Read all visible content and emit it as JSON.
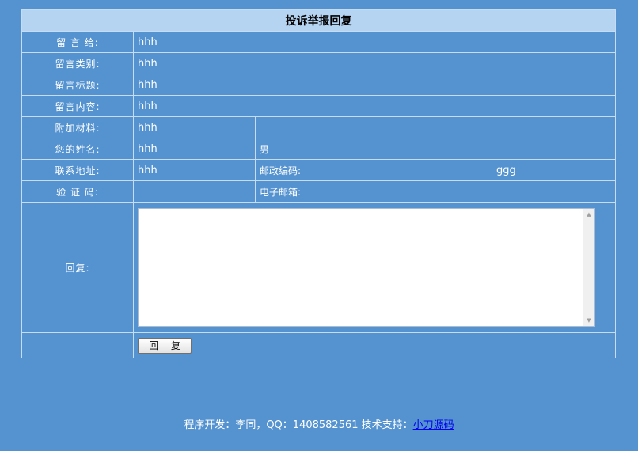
{
  "title": "投诉举报回复",
  "fields": {
    "to": {
      "label": "留 言 给:",
      "value": "hhh"
    },
    "category": {
      "label": "留言类别:",
      "value": "hhh"
    },
    "subject": {
      "label": "留言标题:",
      "value": "hhh"
    },
    "content": {
      "label": "留言内容:",
      "value": "hhh"
    },
    "attachment": {
      "label": "附加材料:",
      "value": "hhh"
    },
    "name": {
      "label": "您的姓名:",
      "value": "hhh",
      "gender": "男"
    },
    "address": {
      "label": "联系地址:",
      "value": "hhh",
      "postcode_label": "邮政编码:",
      "postcode_value": "ggg"
    },
    "captcha": {
      "label": "验 证 码:",
      "value": "",
      "email_label": "电子邮箱:",
      "email_value": ""
    }
  },
  "reply": {
    "label": "回复:",
    "value": ""
  },
  "submit_label": "回 复",
  "footer": {
    "text": "程序开发：李同，QQ：1408582561 技术支持：",
    "link_text": "小刀源码"
  }
}
